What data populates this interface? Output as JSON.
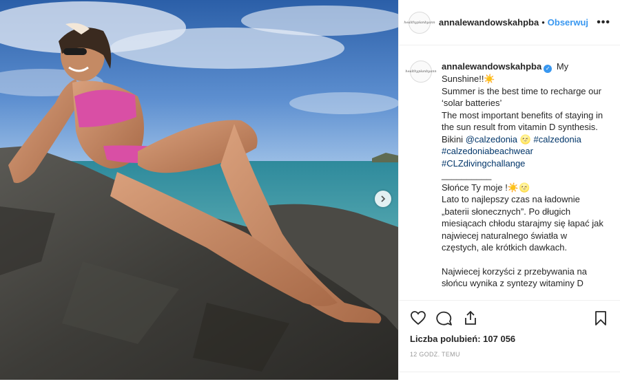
{
  "post": {
    "username": "annalewandowskahpba",
    "follow_label": "Obserwuj",
    "separator": "•",
    "more_label": "•••",
    "avatar_text": "healthyplanbyann"
  },
  "caption": {
    "username": "annalewandowskahpba",
    "verified_mark": "✓",
    "lines": [
      "My Sunshine!!☀️",
      "Summer is the best time to recharge our ‘solar batteries’",
      "The most important benefits of staying in the sun result from vitamin D synthesis."
    ],
    "bikini_prefix": "Bikini ",
    "mention": "@calzedonia",
    "emoji": " 🌝",
    "hashtags": [
      "#calzedonia",
      "#calzedoniabeachwear",
      "#CLZdivingchallange"
    ],
    "divider": "__________",
    "pl_title": "Słońce Ty moje !☀️🌝",
    "pl_body": "Lato to najlepszy czas na ładownie „baterii słonecznych”. Po długich miesiącach chłodu starajmy się łapać jak najwiecej naturalnego światła w częstych, ale krótkich dawkach.",
    "pl_more": "Najwiecej korzyści z przebywania na słońcu wynika z syntezy witaminy D"
  },
  "actions": {
    "like_icon": "heart-icon",
    "comment_icon": "comment-icon",
    "share_icon": "share-icon",
    "save_icon": "bookmark-icon"
  },
  "likes_text": "Liczba polubień: 107 056",
  "timestamp": "12 GODZ. TEMU",
  "colors": {
    "link": "#3897f0",
    "tag": "#003569",
    "border": "#efefef"
  }
}
